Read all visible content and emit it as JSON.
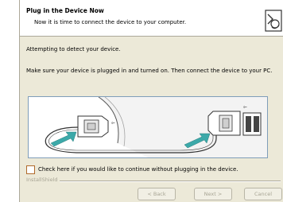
{
  "header": {
    "title": "Plug in the Device Now",
    "subtitle": "Now it is time to connect the device to your computer.",
    "logo_icon": "installer-logo-icon"
  },
  "body": {
    "status": "Attempting to detect your device.",
    "instruction": "Make sure your device is plugged in and turned on.  Then connect the device to your PC."
  },
  "illustration": {
    "icon": "usb-cable-connection-illustration",
    "accent": "#3ca9a9"
  },
  "checkbox": {
    "checked": false,
    "label": "Check here if you would like to continue without plugging in the device."
  },
  "footer": {
    "brand": "InstallShield"
  },
  "buttons": {
    "back": {
      "label": "< Back",
      "enabled": false
    },
    "next": {
      "label": "Next >",
      "enabled": false
    },
    "cancel": {
      "label": "Cancel",
      "enabled": false
    }
  }
}
